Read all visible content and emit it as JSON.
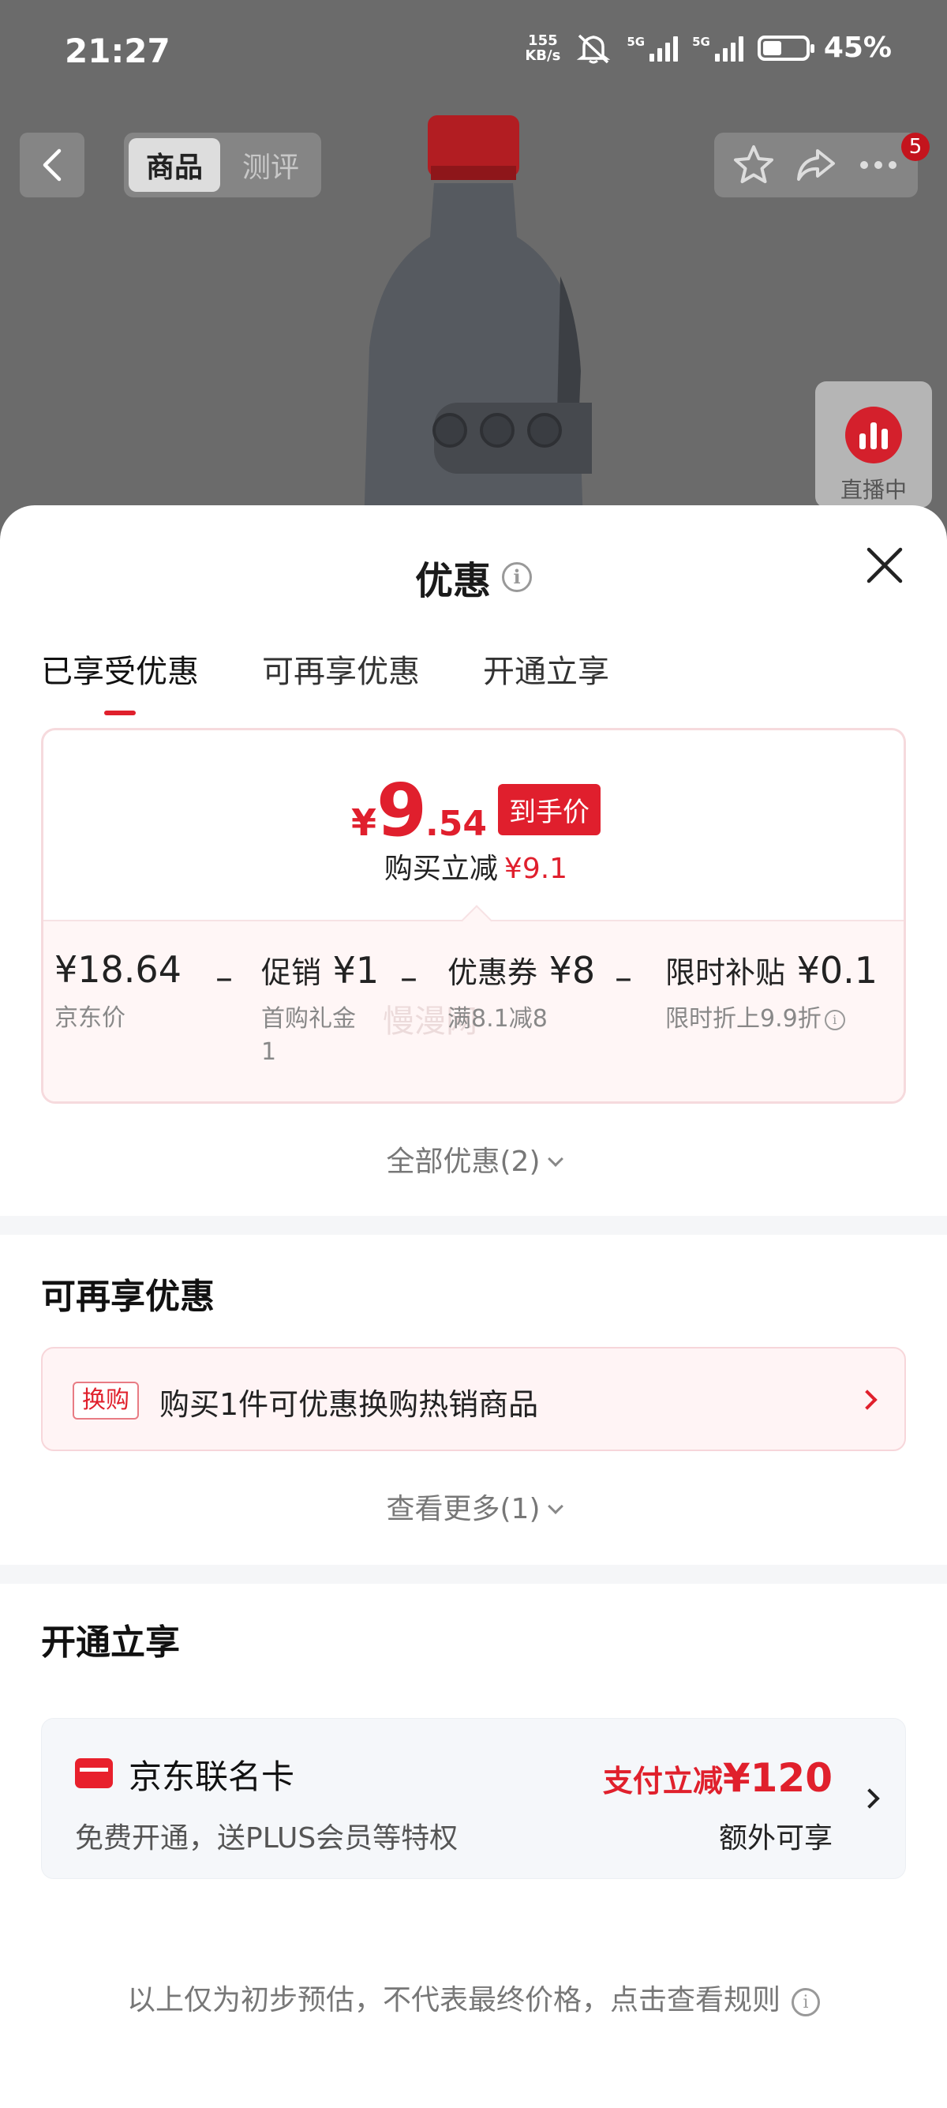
{
  "status_bar": {
    "time": "21:27",
    "net_speed_value": "155",
    "net_speed_unit": "KB/s",
    "signal_1_label": "5G",
    "signal_2_label": "5G",
    "battery": "45%",
    "battery_level": 0.45
  },
  "nav": {
    "tabs": [
      "商品",
      "测评"
    ],
    "active_tab": "商品",
    "more_badge": "5"
  },
  "live_float": {
    "label": "直播中"
  },
  "sheet": {
    "title": "优惠",
    "info_glyph": "i",
    "tabs": [
      "已享受优惠",
      "可再享优惠",
      "开通立享"
    ],
    "active_tab": "已享受优惠",
    "price": {
      "symbol": "¥",
      "integer": "9",
      "decimal": ".54",
      "tag": "到手价",
      "reduce_label": "购买立减",
      "reduce_amount": "¥9.1"
    },
    "breakdown": [
      {
        "amount": "¥18.64",
        "label": "",
        "sub": "京东价"
      },
      {
        "amount": "¥1",
        "label": "促销",
        "sub": "首购礼金",
        "sub2": "1"
      },
      {
        "amount": "¥8",
        "label": "优惠券",
        "sub": "满8.1减8"
      },
      {
        "amount": "¥0.1",
        "label": "限时补贴",
        "sub": "限时折上9.9折"
      }
    ],
    "minus_sign": "–",
    "watermark": "慢漫网",
    "all_offers_link": "全部优惠(2)",
    "more_section": {
      "title": "可再享优惠",
      "tag": "换购",
      "text": "购买1件可优惠换购热销商品",
      "more_link": "查看更多(1)"
    },
    "open_section": {
      "title": "开通立享",
      "card_name": "京东联名卡",
      "card_desc": "免费开通，送PLUS会员等特权",
      "promo_label": "支付立减",
      "promo_amount": "¥120",
      "extra": "额外可享"
    },
    "footer_note": "以上仅为初步预估，不代表最终价格，点击查看规则"
  },
  "colors": {
    "accent_red": "#e01f2d",
    "overlay": "rgba(0,0,0,0.58)"
  }
}
